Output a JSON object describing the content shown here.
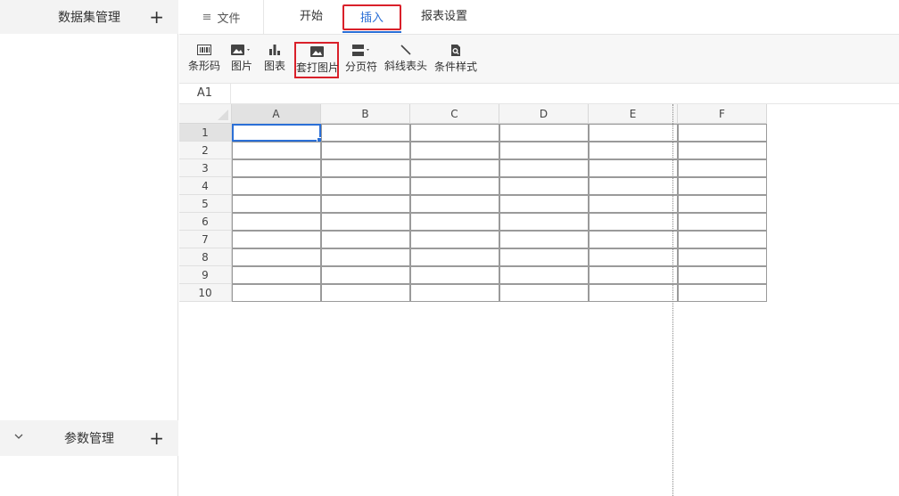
{
  "sidebar": {
    "dataset_title": "数据集管理",
    "param_title": "参数管理",
    "add_symbol": "+"
  },
  "topbar": {
    "file_label": "文件",
    "tabs": [
      {
        "label": "开始"
      },
      {
        "label": "插入",
        "active": true
      },
      {
        "label": "报表设置"
      }
    ]
  },
  "ribbon": {
    "items": [
      {
        "label": "条形码",
        "icon": "barcode-icon"
      },
      {
        "label": "图片",
        "icon": "image-icon"
      },
      {
        "label": "图表",
        "icon": "bar-chart-icon"
      },
      {
        "label": "套打图片",
        "icon": "image-icon",
        "highlighted": true
      },
      {
        "label": "分页符",
        "icon": "page-break-icon"
      },
      {
        "label": "斜线表头",
        "icon": "diagonal-line-icon"
      },
      {
        "label": "条件样式",
        "icon": "conditional-style-icon"
      }
    ]
  },
  "formula_bar": {
    "cell_ref": "A1"
  },
  "grid": {
    "columns": [
      "A",
      "B",
      "C",
      "D",
      "E",
      "F"
    ],
    "rows": [
      "1",
      "2",
      "3",
      "4",
      "5",
      "6",
      "7",
      "8",
      "9",
      "10"
    ],
    "selected_cell": "A1"
  },
  "colors": {
    "accent": "#2b6fd6",
    "highlight_border": "#d9202a"
  }
}
